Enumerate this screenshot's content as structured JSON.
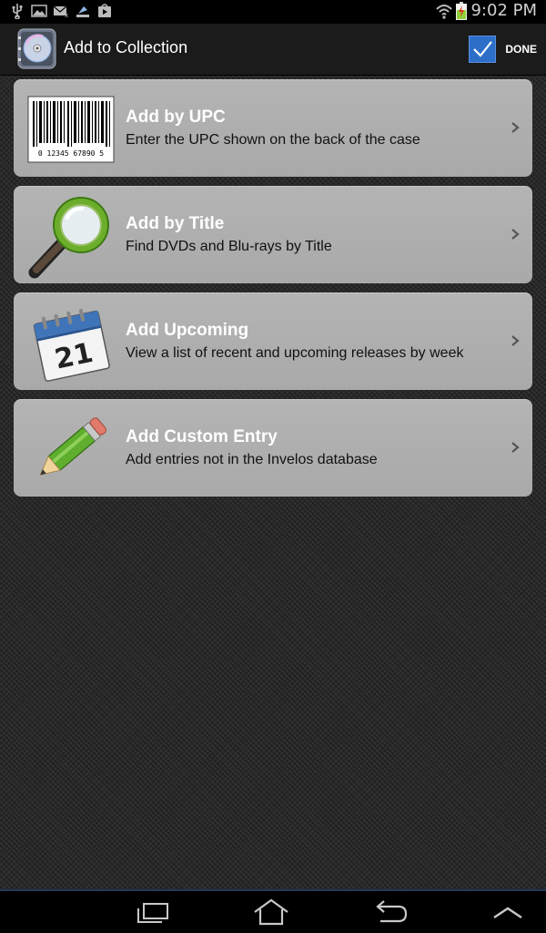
{
  "status_bar": {
    "time": "9:02 PM",
    "left_icons": [
      "usb-icon",
      "image-icon",
      "mail-icon",
      "download-icon",
      "play-store-icon"
    ],
    "right_icons": [
      "wifi-icon",
      "battery-charging-icon"
    ]
  },
  "action_bar": {
    "title": "Add to Collection",
    "app_icon": "dvd-collection-icon",
    "done_label": "DONE"
  },
  "menu": {
    "items": [
      {
        "title": "Add by UPC",
        "subtitle": "Enter the UPC shown on the back of the case",
        "icon": "barcode-icon",
        "barcode_digits": "0  12345  67890  5"
      },
      {
        "title": "Add by Title",
        "subtitle": "Find DVDs and Blu-rays by Title",
        "icon": "magnifier-icon"
      },
      {
        "title": "Add Upcoming",
        "subtitle": "View a list of recent and upcoming releases by week",
        "icon": "calendar-icon",
        "calendar_day": "21"
      },
      {
        "title": "Add Custom Entry",
        "subtitle": "Add entries not in the Invelos database",
        "icon": "pencil-icon"
      }
    ]
  },
  "nav_bar": {
    "buttons": [
      "recent-apps-icon",
      "home-icon",
      "back-icon",
      "menu-up-icon"
    ]
  },
  "colors": {
    "card_background": "#b0b0b0",
    "action_bar": "#1b1b1b",
    "accent": "#2d6ec8"
  }
}
